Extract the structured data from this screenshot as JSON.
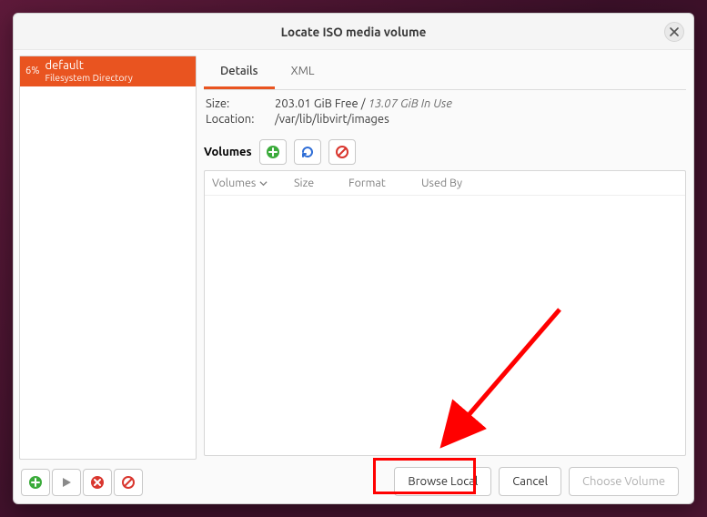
{
  "window": {
    "title": "Locate ISO media volume"
  },
  "sidebar": {
    "pool": {
      "usage_percent": "6%",
      "name": "default",
      "type": "Filesystem Directory"
    }
  },
  "tabs": {
    "details": "Details",
    "xml": "XML",
    "active": "details"
  },
  "info": {
    "size_label": "Size:",
    "size_free": "203.01 GiB Free",
    "size_in_use": "13.07 GiB In Use",
    "location_label": "Location:",
    "location_value": "/var/lib/libvirt/images"
  },
  "volumes": {
    "label": "Volumes",
    "columns": {
      "volumes": "Volumes",
      "size": "Size",
      "format": "Format",
      "used_by": "Used By"
    },
    "rows": []
  },
  "footer": {
    "browse_local": "Browse Local",
    "cancel": "Cancel",
    "choose_volume": "Choose Volume"
  },
  "icons": {
    "close": "close-icon",
    "add": "add-icon",
    "play": "play-icon",
    "stop": "stop-icon",
    "forbid": "forbid-icon",
    "refresh": "refresh-icon"
  }
}
